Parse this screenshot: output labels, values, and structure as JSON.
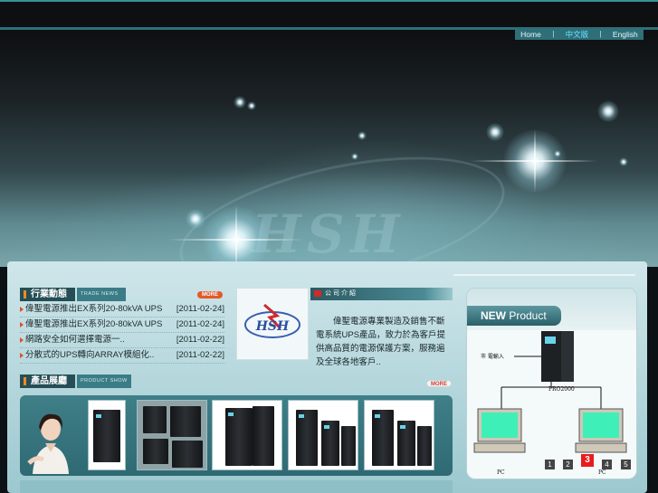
{
  "top_glyph": "",
  "nav": {
    "items": [
      {
        "label": "Home",
        "active": false
      },
      {
        "label": "中文版",
        "active": true
      },
      {
        "label": "English",
        "active": false
      }
    ],
    "separator": "|"
  },
  "banner": {
    "logo_text": "HSH"
  },
  "content": {
    "glyph_top": "",
    "glyph_mid": "",
    "glyph_bottom": ""
  },
  "news": {
    "heading": "行業動態",
    "heading_sub": "TRADE NEWS",
    "more_label": "MORE",
    "items": [
      {
        "title": "偉聖電源推出EX系列20-80kVA UPS",
        "display": "偉聖電源推出EX系列20-80kVA UPS",
        "date": "[2011-02-24]"
      },
      {
        "title": "偉聖電源推出EX系列20-80kVA UPS",
        "display": "偉聖電源推出EX系列20-80kVA UPS",
        "date": "[2011-02-24]"
      },
      {
        "title": "網路安全如何選擇電源一..",
        "display": "網路安全如何選擇電源一..",
        "date": "[2011-02-22]"
      },
      {
        "title": "分散式的UPS轉向ARRAY模組化..",
        "display": "分散式的UPS轉向ARRAY模組化..",
        "date": "[2011-02-22]"
      }
    ]
  },
  "company": {
    "heading": "公司介紹",
    "logo_text": "HSH",
    "intro": "　　偉聖電源專業製造及銷售不斷電系統UPS產品，致力於為客戶提供高品質的電源保護方案，服務遍及全球各地客戶.."
  },
  "products": {
    "heading": "產品展廳",
    "heading_sub": "PRODUCT SHOW",
    "more_label": "MORE"
  },
  "new_product": {
    "title_bold": "NEW",
    "title_rest": " Product",
    "diagram": {
      "input_label": "市 電輸入",
      "server_label": "PRO2000",
      "pc_left": "PC",
      "pc_right": "PC"
    },
    "pager": [
      "1",
      "2",
      "3",
      "4",
      "5"
    ],
    "active_page": "3"
  },
  "colors": {
    "accent": "#2e6f79",
    "nav_active": "#6ee0ff",
    "more_button": "#e35a2a",
    "pager_active": "#e81c1c"
  }
}
